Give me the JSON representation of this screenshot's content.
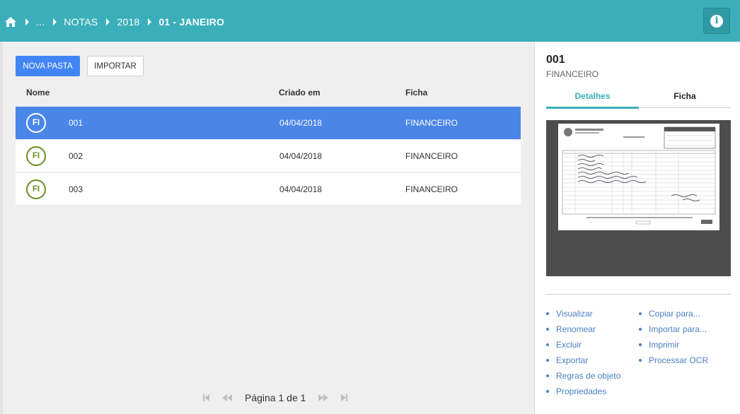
{
  "breadcrumb": {
    "home_icon": "home-icon",
    "items": [
      "...",
      "NOTAS",
      "2018",
      "01 - JANEIRO"
    ]
  },
  "header": {
    "info_icon": "info-icon",
    "info_glyph": "i"
  },
  "toolbar": {
    "new_folder_label": "NOVA PASTA",
    "import_label": "IMPORTAR"
  },
  "table": {
    "columns": [
      "Nome",
      "Criado em",
      "Ficha"
    ],
    "rows": [
      {
        "badge": "FI",
        "name": "001",
        "created": "04/04/2018",
        "ficha": "FINANCEIRO",
        "selected": true
      },
      {
        "badge": "FI",
        "name": "002",
        "created": "04/04/2018",
        "ficha": "FINANCEIRO",
        "selected": false
      },
      {
        "badge": "FI",
        "name": "003",
        "created": "04/04/2018",
        "ficha": "FINANCEIRO",
        "selected": false
      }
    ]
  },
  "pagination": {
    "label": "Página 1 de 1"
  },
  "details": {
    "title": "001",
    "subtitle": "FINANCEIRO",
    "tabs": [
      "Detalhes",
      "Ficha"
    ],
    "actions_left": [
      "Visualizar",
      "Renomear",
      "Excluir",
      "Exportar",
      "Regras de objeto",
      "Propriedades"
    ],
    "actions_right": [
      "Copiar para...",
      "Importar para...",
      "Imprimir",
      "Processar OCR"
    ]
  },
  "colors": {
    "accent": "#3aafb9",
    "primary": "#4a86e8",
    "badge": "#6b8e23",
    "link": "#4a7fc1"
  }
}
